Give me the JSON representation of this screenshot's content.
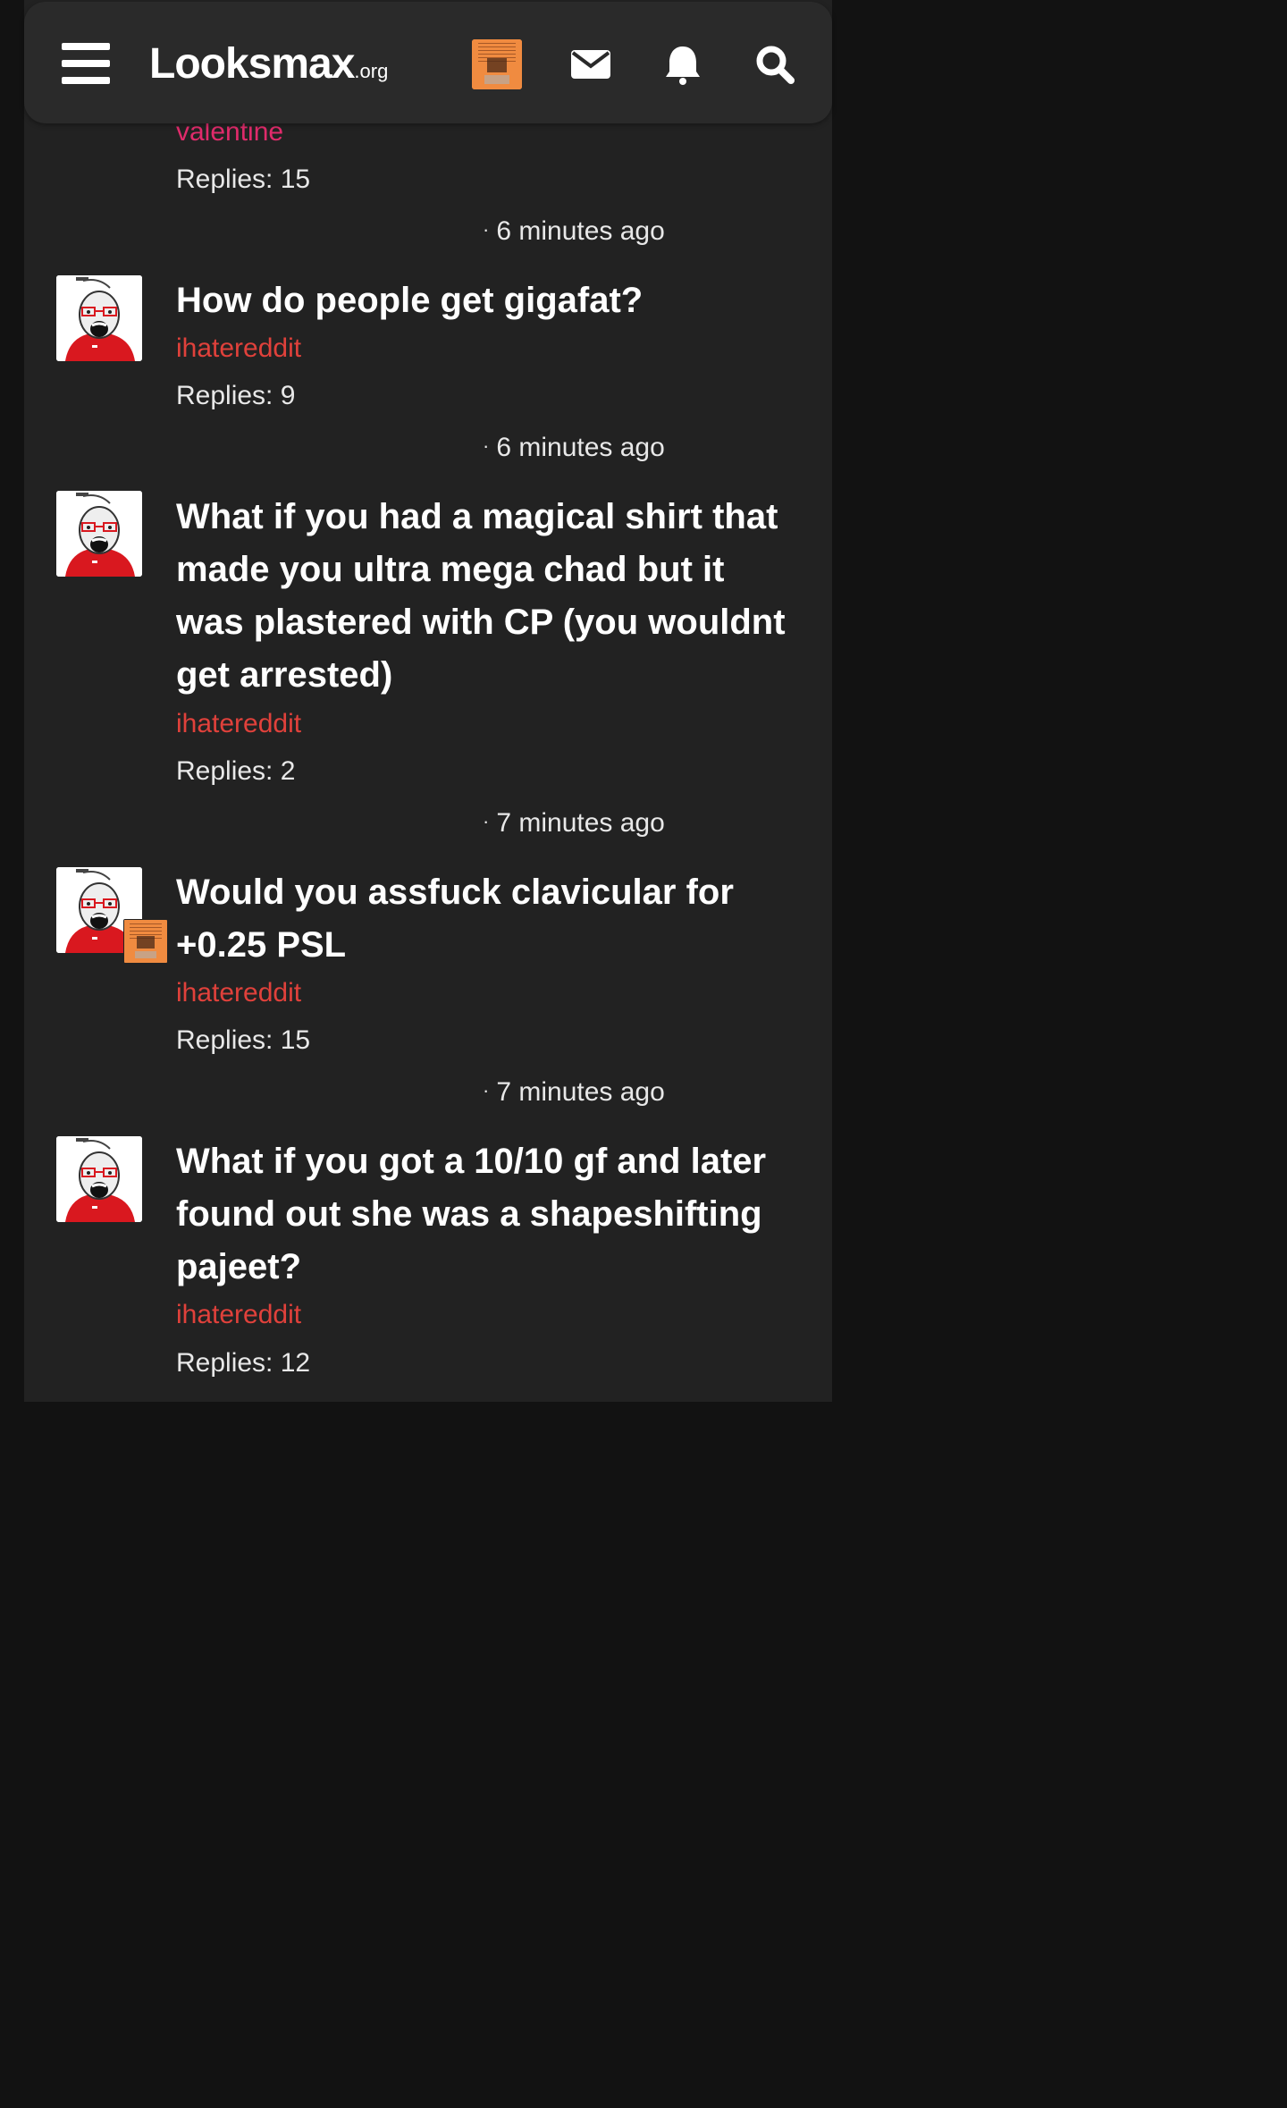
{
  "header": {
    "logo_main": "Looksmax",
    "logo_tld": ".org",
    "icons": [
      "menu-icon",
      "user-avatar",
      "envelope-icon",
      "bell-icon",
      "search-icon"
    ]
  },
  "colors": {
    "page_bg": "#121212",
    "panel_bg": "#222222",
    "header_bg": "#2a2a2a",
    "username_red": "#e0413b",
    "username_pink": "#e02b6b",
    "text": "#ffffff"
  },
  "threads": [
    {
      "title": "",
      "author": "valentine",
      "author_color": "#e02b6b",
      "replies": "Replies: 15",
      "time": "6 minutes ago"
    },
    {
      "title": "How do people get gigafat?",
      "author": "ihatereddit",
      "author_color": "#e0413b",
      "replies": "Replies: 9",
      "time": "6 minutes ago"
    },
    {
      "title": "What if you had a magical shirt that made you ultra mega chad but it was plastered with CP (you wouldnt get arrested)",
      "author": "ihatereddit",
      "author_color": "#e0413b",
      "replies": "Replies: 2",
      "time": "7 minutes ago"
    },
    {
      "title": "Would you assfuck clavicular for +0.25 PSL",
      "author": "ihatereddit",
      "author_color": "#e0413b",
      "replies": "Replies: 15",
      "time": "7 minutes ago"
    },
    {
      "title": "What if you got a 10/10 gf and later found out she was a shapeshifting pajeet?",
      "author": "ihatereddit",
      "author_color": "#e0413b",
      "replies": "Replies: 12",
      "time": ""
    }
  ]
}
